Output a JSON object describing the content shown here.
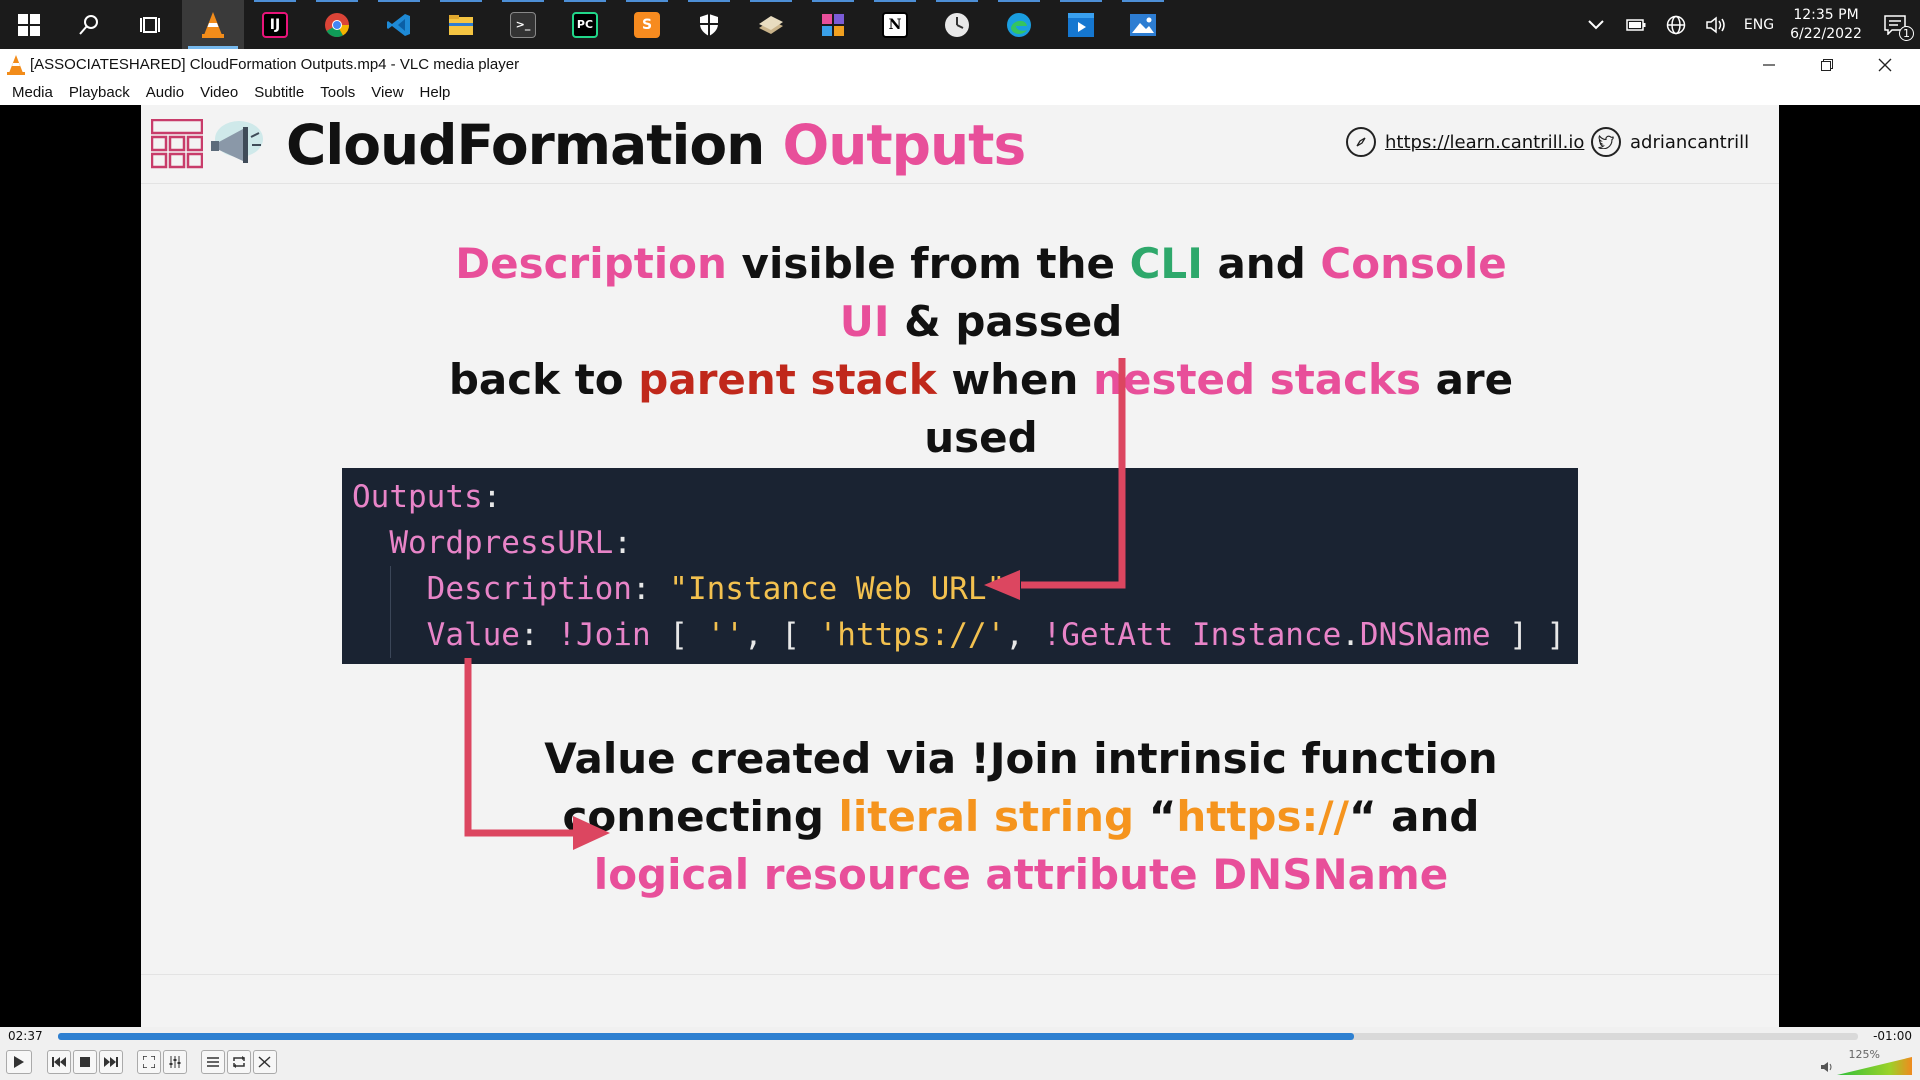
{
  "taskbar": {
    "apps": [
      {
        "name": "vlc-icon",
        "label": ""
      },
      {
        "name": "intellij-icon",
        "label": "IJ"
      },
      {
        "name": "chrome-icon",
        "label": ""
      },
      {
        "name": "vscode-icon",
        "label": ""
      },
      {
        "name": "file-explorer-icon",
        "label": ""
      },
      {
        "name": "terminal-icon",
        "label": ">_"
      },
      {
        "name": "pycharm-icon",
        "label": "PC"
      },
      {
        "name": "sublime-icon",
        "label": "S"
      },
      {
        "name": "security-icon",
        "label": ""
      },
      {
        "name": "app-icon",
        "label": ""
      },
      {
        "name": "app-icon-2",
        "label": ""
      },
      {
        "name": "notion-icon",
        "label": "N"
      },
      {
        "name": "clock-app-icon",
        "label": ""
      },
      {
        "name": "edge-icon",
        "label": ""
      },
      {
        "name": "media-player-icon",
        "label": ""
      },
      {
        "name": "photos-icon",
        "label": ""
      }
    ],
    "tray": {
      "language": "ENG",
      "time": "12:35 PM",
      "date": "6/22/2022",
      "notification_count": "1"
    }
  },
  "window": {
    "title": "[ASSOCIATESHARED] CloudFormation Outputs.mp4 - VLC media player"
  },
  "menu": [
    "Media",
    "Playback",
    "Audio",
    "Video",
    "Subtitle",
    "Tools",
    "View",
    "Help"
  ],
  "slide": {
    "title_main": "CloudFormation",
    "title_accent": "Outputs",
    "link_url": "https://learn.cantrill.io",
    "link_twitter": "adriancantrill",
    "caption_top": {
      "w1": "Description",
      "w2": " visible from the ",
      "w3": "CLI",
      "w4": " and ",
      "w5": "Console UI",
      "w6": " & passed",
      "w7": "back to ",
      "w8": "parent stack",
      "w9": " when ",
      "w10": "nested stacks",
      "w11": " are used"
    },
    "code": {
      "l1_key": "Outputs",
      "l2_key": "WordpressURL",
      "l3_key": "Description",
      "l3_val": "\"Instance Web URL\"",
      "l4_key": "Value",
      "l4_fn": "!Join",
      "l4_a": "''",
      "l4_b": "'https://'",
      "l4_fn2": "!GetAtt",
      "l4_res": "Instance",
      "l4_attr": "DNSName"
    },
    "caption_bottom": {
      "l1": "Value created via !Join intrinsic function",
      "l2a": "connecting ",
      "l2b": "literal string",
      "l2c": " “",
      "l2d": "https://",
      "l2e": "“ and",
      "l3": "logical resource attribute DNSName"
    },
    "colors": {
      "pink": "#e84f9a",
      "green": "#2ea86b",
      "red": "#c0281b",
      "orange": "#f5941e",
      "arrow": "#dc4660"
    }
  },
  "player": {
    "time_current": "02:37",
    "time_remaining": "-01:00",
    "progress": 0.72,
    "volume": "125%"
  }
}
